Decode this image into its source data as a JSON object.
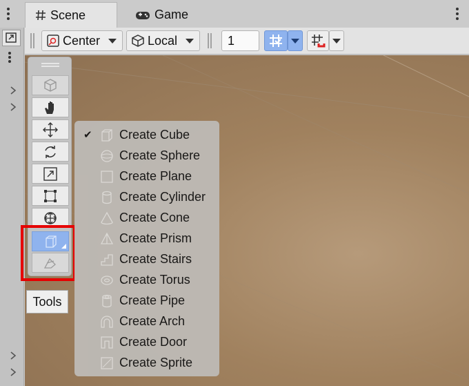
{
  "tabs": [
    {
      "label": "Scene",
      "icon": "grid-hash-icon",
      "active": true
    },
    {
      "label": "Game",
      "icon": "gamepad-icon",
      "active": false
    }
  ],
  "toolbar": {
    "pivot": "Center",
    "space": "Local",
    "grid_size": "1"
  },
  "palette": {
    "tools": [
      "view-cube",
      "hand",
      "move",
      "rotate",
      "scale",
      "rect",
      "transform",
      "create-shape",
      "edit-shape"
    ]
  },
  "tools_label": "Tools",
  "menu": {
    "items": [
      {
        "label": "Create Cube",
        "checked": true,
        "icon": "cube-outline-icon"
      },
      {
        "label": "Create Sphere",
        "checked": false,
        "icon": "sphere-outline-icon"
      },
      {
        "label": "Create Plane",
        "checked": false,
        "icon": "plane-outline-icon"
      },
      {
        "label": "Create Cylinder",
        "checked": false,
        "icon": "cylinder-outline-icon"
      },
      {
        "label": "Create Cone",
        "checked": false,
        "icon": "cone-outline-icon"
      },
      {
        "label": "Create Prism",
        "checked": false,
        "icon": "prism-outline-icon"
      },
      {
        "label": "Create Stairs",
        "checked": false,
        "icon": "stairs-outline-icon"
      },
      {
        "label": "Create Torus",
        "checked": false,
        "icon": "torus-outline-icon"
      },
      {
        "label": "Create Pipe",
        "checked": false,
        "icon": "pipe-outline-icon"
      },
      {
        "label": "Create Arch",
        "checked": false,
        "icon": "arch-outline-icon"
      },
      {
        "label": "Create Door",
        "checked": false,
        "icon": "door-outline-icon"
      },
      {
        "label": "Create Sprite",
        "checked": false,
        "icon": "sprite-outline-icon"
      }
    ],
    "check_glyph": "✔"
  },
  "colors": {
    "accent": "#8fb3ee",
    "highlight": "#e60000",
    "scene_floor": "#a0815e"
  }
}
